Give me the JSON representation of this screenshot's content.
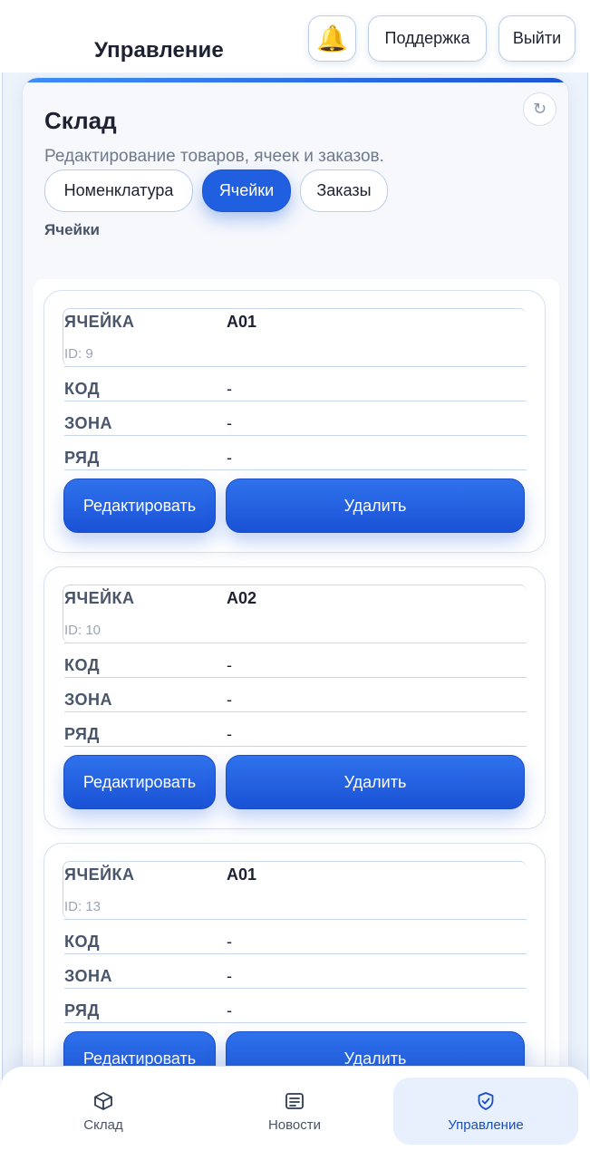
{
  "header": {
    "title": "Управление",
    "bell_icon": "bell-icon",
    "bell_glyph": "🔔",
    "support_label": "Поддержка",
    "logout_label": "Выйти"
  },
  "panel": {
    "title": "Склад",
    "refresh_glyph": "↻",
    "subtitle": "Редактирование товаров, ячеек и заказов.",
    "tabs": [
      {
        "label": "Номенклатура",
        "active": false
      },
      {
        "label": "Ячейки",
        "active": true
      },
      {
        "label": "Заказы",
        "active": false
      }
    ],
    "section_label": "Ячейки"
  },
  "cells": [
    {
      "cell_label": "ЯЧЕЙКА",
      "cell_value": "A01",
      "id_text": "ID: 9",
      "code_label": "КОД",
      "code_value": "-",
      "zone_label": "ЗОНА",
      "zone_value": "-",
      "row_label": "РЯД",
      "row_value": "-",
      "edit_label": "Редактировать",
      "delete_label": "Удалить"
    },
    {
      "cell_label": "ЯЧЕЙКА",
      "cell_value": "A02",
      "id_text": "ID: 10",
      "code_label": "КОД",
      "code_value": "-",
      "zone_label": "ЗОНА",
      "zone_value": "-",
      "row_label": "РЯД",
      "row_value": "-",
      "edit_label": "Редактировать",
      "delete_label": "Удалить"
    },
    {
      "cell_label": "ЯЧЕЙКА",
      "cell_value": "A01",
      "id_text": "ID: 13",
      "code_label": "КОД",
      "code_value": "-",
      "zone_label": "ЗОНА",
      "zone_value": "-",
      "row_label": "РЯД",
      "row_value": "-",
      "edit_label": "Редактировать",
      "delete_label": "Удалить"
    }
  ],
  "bottom_nav": {
    "items": [
      {
        "label": "Склад",
        "icon": "box-icon",
        "active": false
      },
      {
        "label": "Новости",
        "icon": "newspaper-icon",
        "active": false
      },
      {
        "label": "Управление",
        "icon": "shield-check-icon",
        "active": true
      }
    ]
  },
  "colors": {
    "accent": "#1f5fe0",
    "border": "#b9cdea",
    "active_nav_bg": "#e7f0fc"
  }
}
